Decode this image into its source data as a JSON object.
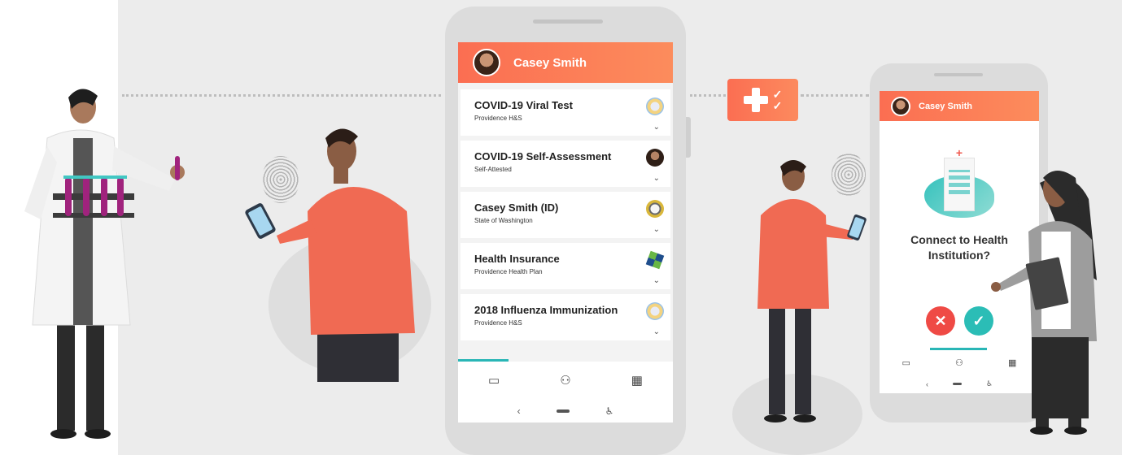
{
  "large_phone": {
    "user_name": "Casey Smith",
    "cards": [
      {
        "title": "COVID-19 Viral Test",
        "issuer": "Providence H&S",
        "logo": "hospital-logo"
      },
      {
        "title": "COVID-19 Self-Assessment",
        "issuer": "Self-Attested",
        "logo": "person-avatar"
      },
      {
        "title": "Casey Smith (ID)",
        "issuer": "State of Washington",
        "logo": "state-seal"
      },
      {
        "title": "Health Insurance",
        "issuer": "Providence Health Plan",
        "logo": "star-logo"
      },
      {
        "title": "2018 Influenza Immunization",
        "issuer": "Providence H&S",
        "logo": "hospital-logo"
      }
    ],
    "tabs": [
      {
        "icon": "wallet-icon",
        "glyph": "▭"
      },
      {
        "icon": "connections-icon",
        "glyph": "⚇"
      },
      {
        "icon": "qr-code-icon",
        "glyph": "▦"
      }
    ],
    "nav": {
      "back": "‹",
      "accessibility": "♿︎"
    }
  },
  "small_phone": {
    "user_name": "Casey Smith",
    "prompt": "Connect to Health Institution?",
    "deny": "✕",
    "accept": "✓"
  },
  "colors": {
    "header_gradient_start": "#fb6e52",
    "header_gradient_end": "#fc8c5c",
    "accent_teal": "#29b6b6",
    "deny_red": "#ef4a45",
    "background": "#ececec"
  }
}
